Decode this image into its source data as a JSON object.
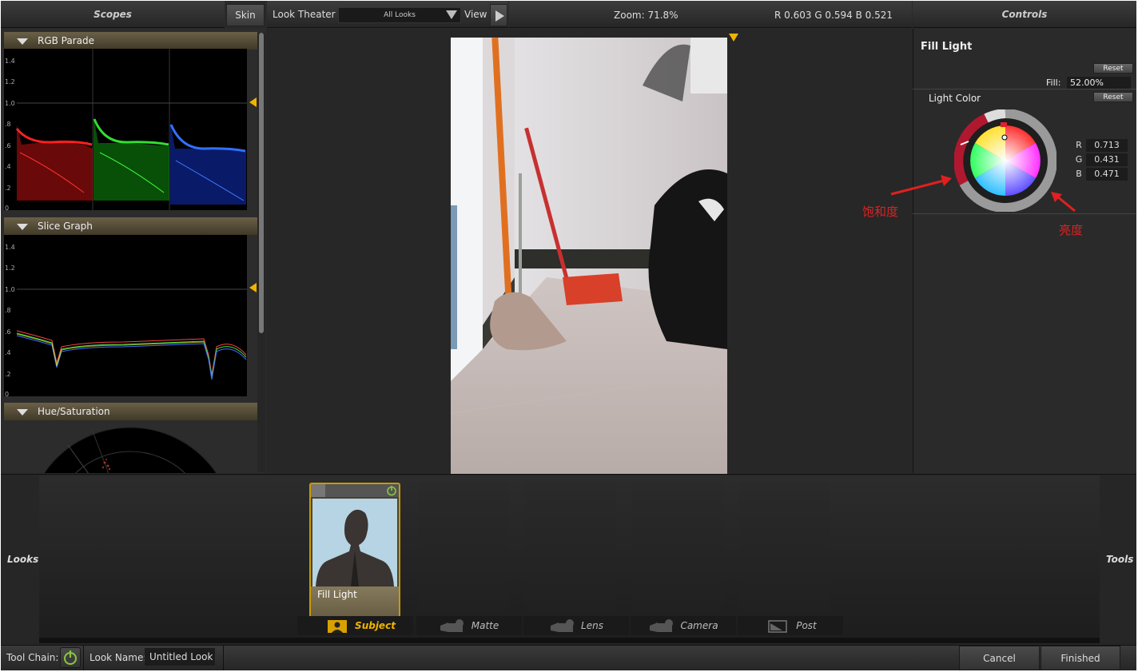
{
  "header": {
    "scopes_title": "Scopes",
    "skin_button": "Skin",
    "look_theater_label": "Look Theater",
    "looks_dropdown_value": "All Looks",
    "view_label": "View",
    "zoom": "Zoom:  71.8%",
    "rgb_readout": "R 0.603   G 0.594   B 0.521",
    "controls_title": "Controls"
  },
  "scopes": {
    "sections": [
      "RGB Parade",
      "Slice Graph",
      "Hue/Saturation"
    ],
    "y_ticks": [
      "1.4",
      "1.2",
      "1.0",
      ".8",
      ".6",
      ".4",
      ".2",
      "0"
    ]
  },
  "controls": {
    "tool_name": "Fill Light",
    "reset_label": "Reset",
    "fill_label": "Fill:",
    "fill_value": "52.00%",
    "light_color_label": "Light Color",
    "r_label": "R",
    "r_value": "0.713",
    "g_label": "G",
    "g_value": "0.431",
    "b_label": "B",
    "b_value": "0.471"
  },
  "annotations": {
    "saturation": "饱和度",
    "brightness": "亮度"
  },
  "tray": {
    "looks_label": "Looks",
    "tools_label": "Tools",
    "active_card_label": "Fill Light",
    "categories": [
      "Subject",
      "Matte",
      "Lens",
      "Camera",
      "Post"
    ]
  },
  "statusbar": {
    "tool_chain_label": "Tool Chain:",
    "look_name_label": "Look Name:",
    "look_name_value": "Untitled Look",
    "cancel": "Cancel",
    "finished": "Finished"
  },
  "colors": {
    "accent": "#f0b400",
    "card_border": "#c89a00",
    "power_green": "#8dc63f",
    "annotation_red": "#e02020"
  }
}
